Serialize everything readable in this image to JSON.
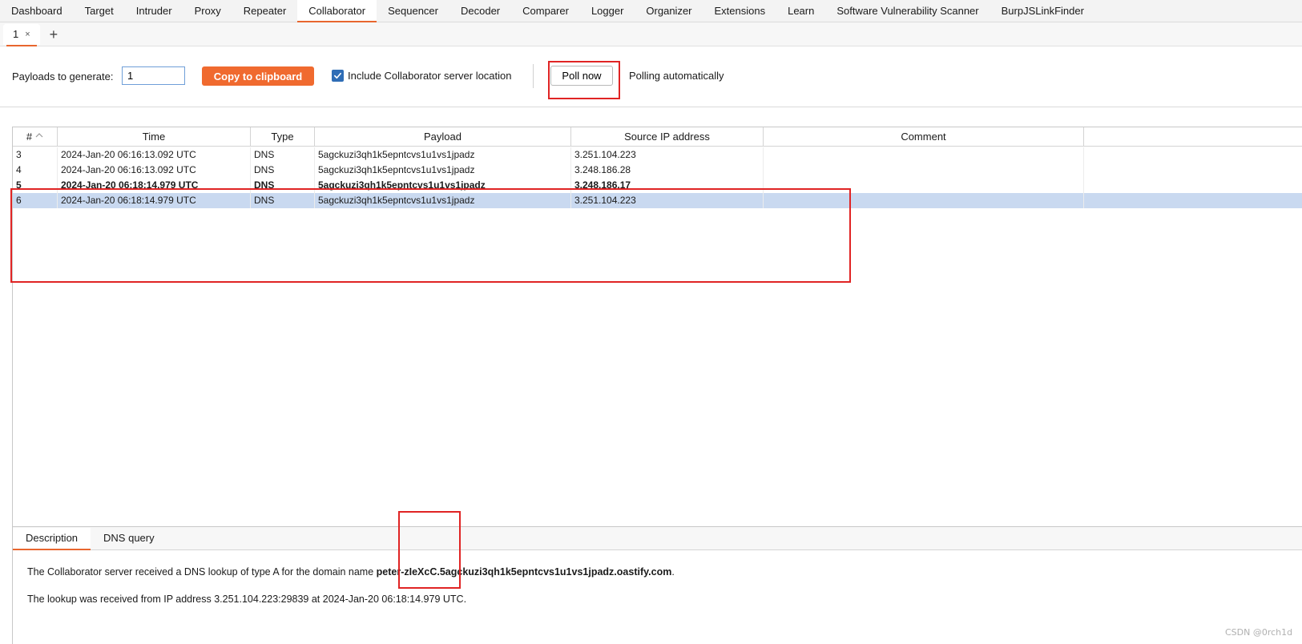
{
  "top_tabs": [
    {
      "label": "Dashboard"
    },
    {
      "label": "Target"
    },
    {
      "label": "Intruder"
    },
    {
      "label": "Proxy"
    },
    {
      "label": "Repeater"
    },
    {
      "label": "Collaborator"
    },
    {
      "label": "Sequencer"
    },
    {
      "label": "Decoder"
    },
    {
      "label": "Comparer"
    },
    {
      "label": "Logger"
    },
    {
      "label": "Organizer"
    },
    {
      "label": "Extensions"
    },
    {
      "label": "Learn"
    },
    {
      "label": "Software Vulnerability Scanner"
    },
    {
      "label": "BurpJSLinkFinder"
    }
  ],
  "active_top_tab": "Collaborator",
  "sub_tabs": [
    {
      "label": "1",
      "close": "×"
    }
  ],
  "add_tab": "+",
  "controls": {
    "payloads_label": "Payloads to generate:",
    "payloads_value": "1",
    "copy_button": "Copy to clipboard",
    "include_checked": true,
    "include_label": "Include Collaborator server location",
    "poll_button": "Poll now",
    "polling_status": "Polling automatically"
  },
  "table": {
    "columns": [
      {
        "label": "#"
      },
      {
        "label": "Time"
      },
      {
        "label": "Type"
      },
      {
        "label": "Payload"
      },
      {
        "label": "Source IP address"
      },
      {
        "label": "Comment"
      }
    ],
    "sort_indicator": "^",
    "rows": [
      {
        "num": "3",
        "time": "2024-Jan-20 06:16:13.092 UTC",
        "type": "DNS",
        "payload": "5agckuzi3qh1k5epntcvs1u1vs1jpadz",
        "ip": "3.251.104.223",
        "comment": "",
        "bold": false,
        "selected": false
      },
      {
        "num": "4",
        "time": "2024-Jan-20 06:16:13.092 UTC",
        "type": "DNS",
        "payload": "5agckuzi3qh1k5epntcvs1u1vs1jpadz",
        "ip": "3.248.186.28",
        "comment": "",
        "bold": false,
        "selected": false
      },
      {
        "num": "5",
        "time": "2024-Jan-20 06:18:14.979 UTC",
        "type": "DNS",
        "payload": "5agckuzi3qh1k5epntcvs1u1vs1jpadz",
        "ip": "3.248.186.17",
        "comment": "",
        "bold": true,
        "selected": false
      },
      {
        "num": "6",
        "time": "2024-Jan-20 06:18:14.979 UTC",
        "type": "DNS",
        "payload": "5agckuzi3qh1k5epntcvs1u1vs1jpadz",
        "ip": "3.251.104.223",
        "comment": "",
        "bold": false,
        "selected": true
      }
    ]
  },
  "detail": {
    "tabs": [
      {
        "label": "Description"
      },
      {
        "label": "DNS query"
      }
    ],
    "line1_prefix": "The Collaborator server received a DNS lookup of type A for the domain name ",
    "line1_domain": "peter-zIeXcC.5agckuzi3qh1k5epntcvs1u1vs1jpadz.oastify.com",
    "line1_suffix": ".",
    "line2": "The lookup was received from IP address 3.251.104.223:29839 at 2024-Jan-20 06:18:14.979 UTC."
  },
  "watermark": "CSDN @0rch1d",
  "colors": {
    "accent": "#f06a2f",
    "selection": "#c9d9f0",
    "annotation": "#e02424",
    "checkbox": "#2f6db6"
  }
}
